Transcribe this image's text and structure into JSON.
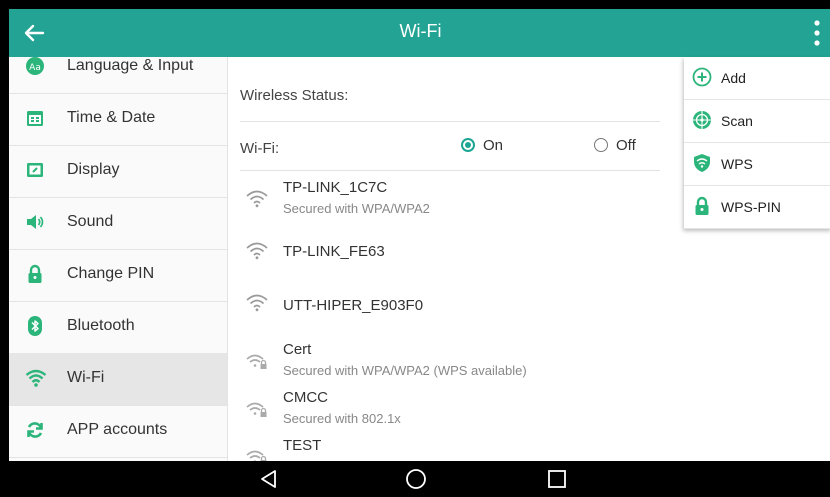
{
  "colors": {
    "accent": "#23a393",
    "icon_green": "#2bb57a",
    "radio_on": "#1ca693"
  },
  "appbar": {
    "title": "Wi-Fi",
    "back_icon": "arrow-left-icon",
    "menu_icon": "more-vert-icon"
  },
  "sidebar": {
    "items": [
      {
        "label": "Language & Input",
        "icon": "language-icon"
      },
      {
        "label": "Time & Date",
        "icon": "calendar-icon"
      },
      {
        "label": "Display",
        "icon": "display-icon"
      },
      {
        "label": "Sound",
        "icon": "speaker-icon"
      },
      {
        "label": "Change PIN",
        "icon": "lock-icon"
      },
      {
        "label": "Bluetooth",
        "icon": "bluetooth-icon"
      },
      {
        "label": "Wi-Fi",
        "icon": "wifi-icon",
        "active": true
      },
      {
        "label": "APP accounts",
        "icon": "sync-icon"
      }
    ]
  },
  "main": {
    "status_label": "Wireless Status:",
    "wifi_label": "Wi-Fi:",
    "radio_on": "On",
    "radio_off": "Off",
    "selected": "On",
    "networks": [
      {
        "ssid": "TP-LINK_1C7C",
        "security": "Secured with WPA/WPA2",
        "locked": false
      },
      {
        "ssid": "TP-LINK_FE63",
        "security": "",
        "locked": false
      },
      {
        "ssid": "UTT-HIPER_E903F0",
        "security": "",
        "locked": false
      },
      {
        "ssid": "Cert",
        "security": "Secured with WPA/WPA2 (WPS available)",
        "locked": true
      },
      {
        "ssid": "CMCC",
        "security": "Secured with 802.1x",
        "locked": true
      },
      {
        "ssid": "TEST",
        "security": "",
        "locked": true
      }
    ]
  },
  "menu": {
    "items": [
      {
        "label": "Add",
        "icon": "add-circle-icon"
      },
      {
        "label": "Scan",
        "icon": "scan-icon"
      },
      {
        "label": "WPS",
        "icon": "shield-icon"
      },
      {
        "label": "WPS-PIN",
        "icon": "lock-icon"
      }
    ]
  },
  "navbar": {
    "back": "back-triangle-icon",
    "home": "home-circle-icon",
    "recents": "recents-square-icon"
  }
}
